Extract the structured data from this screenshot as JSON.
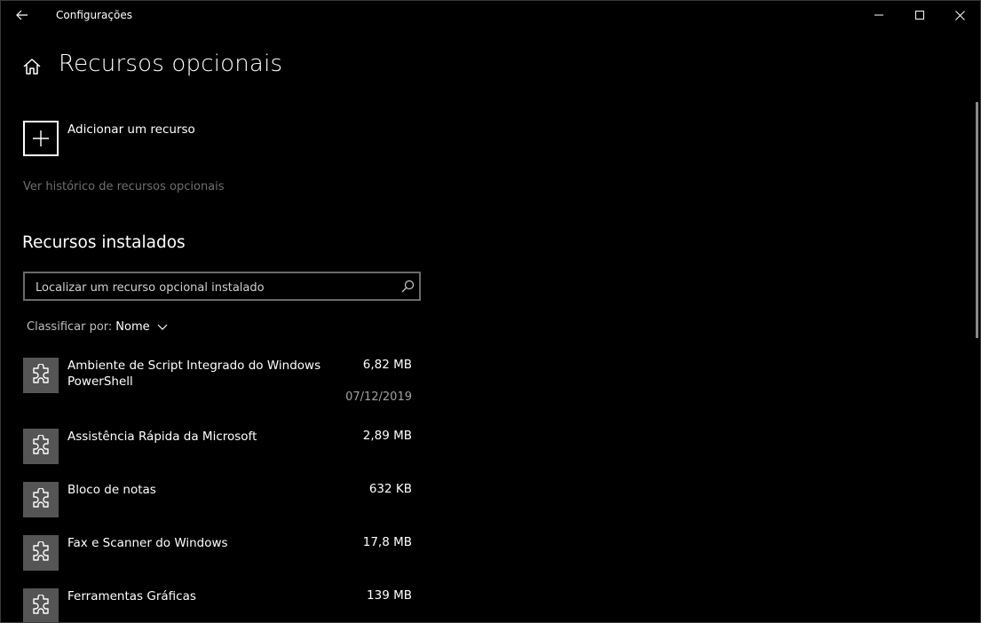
{
  "window": {
    "title": "Configurações"
  },
  "header": {
    "title": "Recursos opcionais"
  },
  "add_feature": {
    "label": "Adicionar um recurso"
  },
  "history_link": "Ver histórico de recursos opcionais",
  "installed": {
    "section_title": "Recursos instalados",
    "search_placeholder": "Localizar um recurso opcional instalado",
    "sort_label": "Classificar por:",
    "sort_value": "Nome",
    "items": [
      {
        "name": "Ambiente de Script Integrado do Windows PowerShell",
        "size": "6,82 MB",
        "date": "07/12/2019"
      },
      {
        "name": "Assistência Rápida da Microsoft",
        "size": "2,89 MB"
      },
      {
        "name": "Bloco de notas",
        "size": "632 KB"
      },
      {
        "name": "Fax e Scanner do Windows",
        "size": "17,8 MB"
      },
      {
        "name": "Ferramentas Gráficas",
        "size": "139 MB"
      }
    ]
  },
  "icons": {
    "back": "back-arrow-icon",
    "home": "home-icon",
    "add": "plus-icon",
    "search": "search-icon",
    "sort": "chevron-down-icon",
    "feature": "puzzle-piece-icon",
    "minimize": "minimize-icon",
    "maximize": "maximize-icon",
    "close": "close-icon"
  }
}
